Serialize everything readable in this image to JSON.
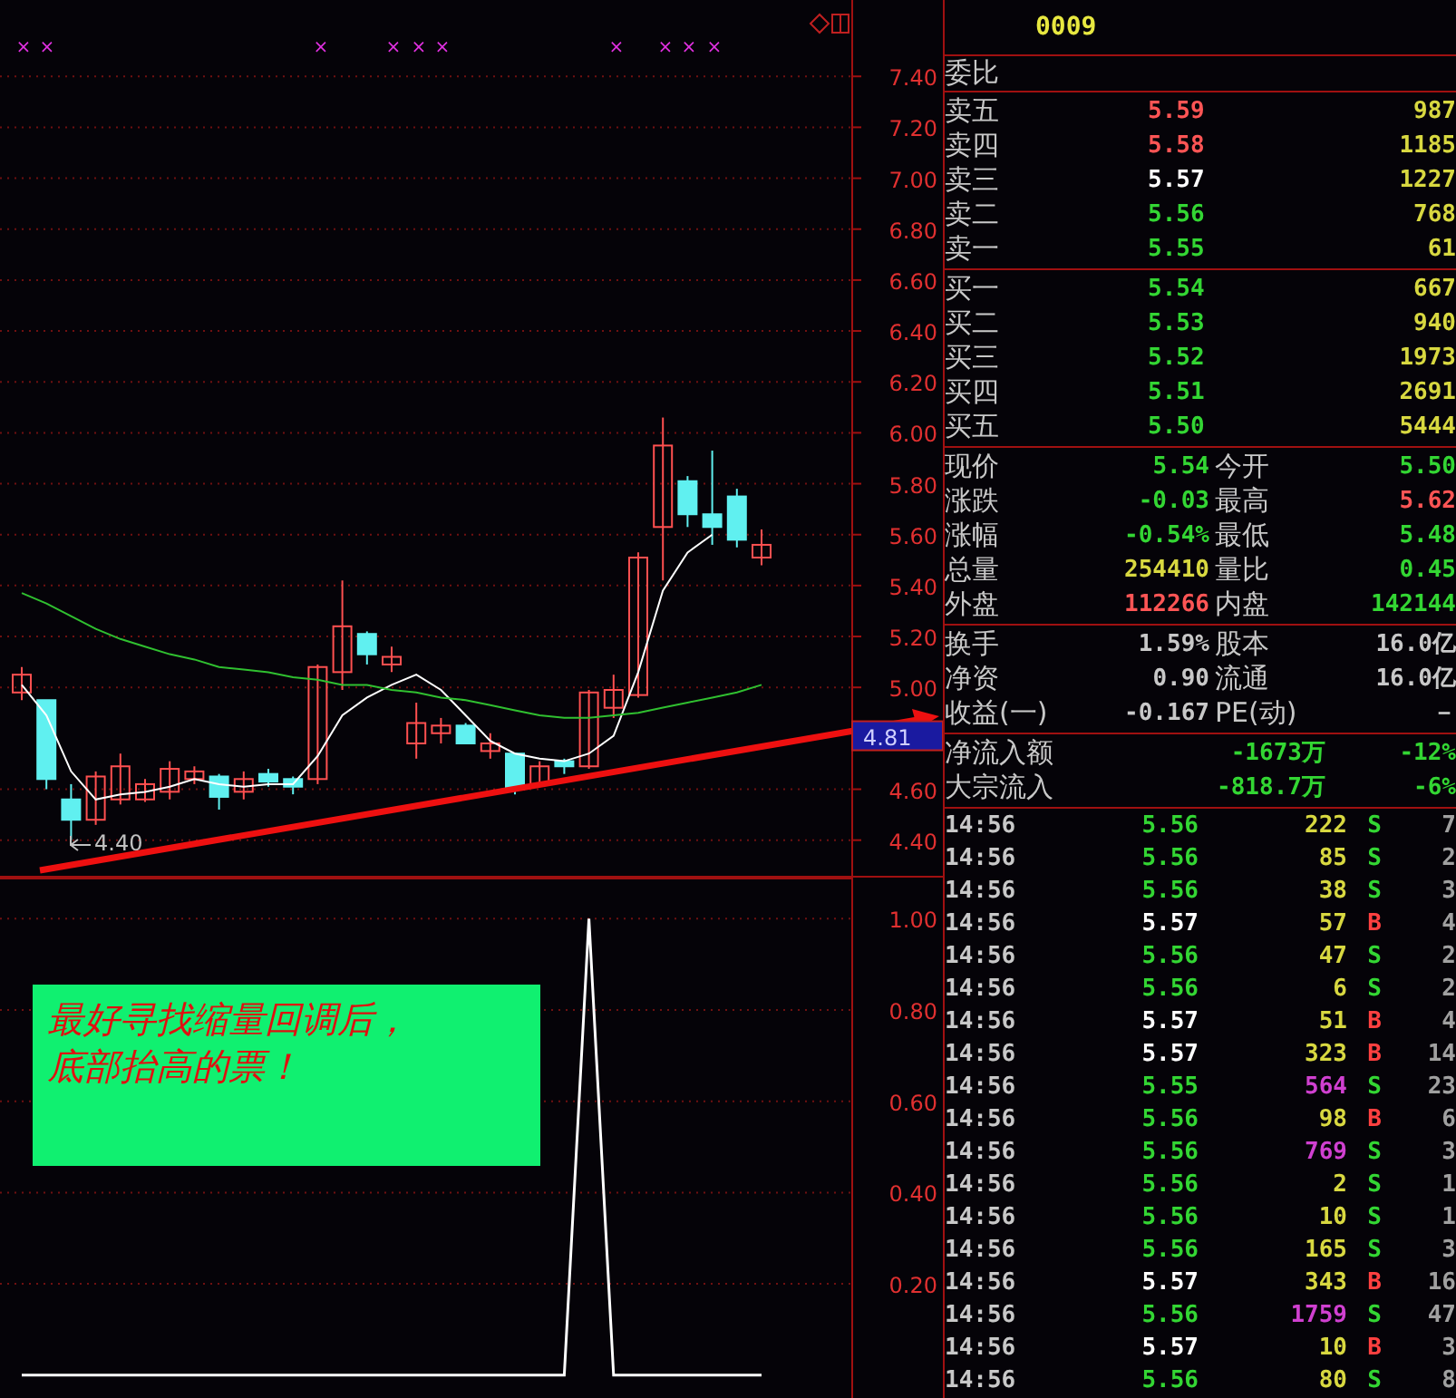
{
  "chart": {
    "chart_data": {
      "type": "candlestick",
      "ylim": [
        4.26,
        7.7
      ],
      "grid": true,
      "yticks": [
        {
          "value": 7.4,
          "label": "7.40"
        },
        {
          "value": 7.2,
          "label": "7.20"
        },
        {
          "value": 7.0,
          "label": "7.00"
        },
        {
          "value": 6.8,
          "label": "6.80"
        },
        {
          "value": 6.6,
          "label": "6.60"
        },
        {
          "value": 6.4,
          "label": "6.40"
        },
        {
          "value": 6.2,
          "label": "6.20"
        },
        {
          "value": 6.0,
          "label": "6.00"
        },
        {
          "value": 5.8,
          "label": "5.80"
        },
        {
          "value": 5.6,
          "label": "5.60"
        },
        {
          "value": 5.4,
          "label": "5.40"
        },
        {
          "value": 5.2,
          "label": "5.20"
        },
        {
          "value": 5.0,
          "label": "5.00"
        },
        {
          "value": 4.6,
          "label": "4.60"
        },
        {
          "value": 4.4,
          "label": "4.40"
        }
      ],
      "ohlc": [
        [
          4.98,
          5.08,
          4.95,
          5.05
        ],
        [
          4.95,
          4.95,
          4.6,
          4.64
        ],
        [
          4.56,
          4.62,
          4.4,
          4.48
        ],
        [
          4.48,
          4.67,
          4.46,
          4.65
        ],
        [
          4.56,
          4.74,
          4.54,
          4.69
        ],
        [
          4.56,
          4.64,
          4.55,
          4.62
        ],
        [
          4.59,
          4.71,
          4.56,
          4.68
        ],
        [
          4.64,
          4.69,
          4.62,
          4.67
        ],
        [
          4.65,
          4.66,
          4.52,
          4.57
        ],
        [
          4.59,
          4.67,
          4.56,
          4.64
        ],
        [
          4.66,
          4.68,
          4.61,
          4.63
        ],
        [
          4.64,
          4.65,
          4.58,
          4.61
        ],
        [
          4.64,
          5.09,
          4.62,
          5.08
        ],
        [
          5.06,
          5.42,
          4.99,
          5.24
        ],
        [
          5.21,
          5.22,
          5.09,
          5.13
        ],
        [
          5.09,
          5.16,
          5.06,
          5.12
        ],
        [
          4.78,
          4.94,
          4.72,
          4.86
        ],
        [
          4.82,
          4.88,
          4.78,
          4.85
        ],
        [
          4.85,
          4.86,
          4.78,
          4.78
        ],
        [
          4.75,
          4.82,
          4.72,
          4.78
        ],
        [
          4.74,
          4.74,
          4.58,
          4.6
        ],
        [
          4.62,
          4.71,
          4.61,
          4.69
        ],
        [
          4.71,
          4.72,
          4.66,
          4.69
        ],
        [
          4.69,
          4.99,
          4.68,
          4.98
        ],
        [
          4.92,
          5.05,
          4.88,
          4.99
        ],
        [
          4.97,
          5.53,
          4.96,
          5.51
        ],
        [
          5.63,
          6.06,
          5.42,
          5.95
        ],
        [
          5.81,
          5.83,
          5.63,
          5.68
        ],
        [
          5.68,
          5.93,
          5.56,
          5.63
        ],
        [
          5.75,
          5.78,
          5.55,
          5.58
        ],
        [
          5.51,
          5.62,
          5.48,
          5.56
        ]
      ],
      "series": [
        {
          "type": "line",
          "color": "#ffffff",
          "values": [
            5.01,
            4.89,
            4.67,
            4.56,
            4.58,
            4.59,
            4.61,
            4.64,
            4.62,
            4.61,
            4.62,
            4.62,
            4.73,
            4.89,
            4.96,
            5.01,
            5.05,
            4.99,
            4.89,
            4.79,
            4.74,
            4.72,
            4.71,
            4.74,
            4.81,
            5.06,
            5.38,
            5.53,
            5.6,
            null,
            null
          ]
        },
        {
          "type": "line",
          "color": "#30c030",
          "values": [
            5.37,
            5.33,
            5.28,
            5.23,
            5.19,
            5.16,
            5.13,
            5.11,
            5.08,
            5.07,
            5.06,
            5.04,
            5.03,
            5.01,
            5.01,
            4.99,
            4.98,
            4.96,
            4.95,
            4.93,
            4.91,
            4.89,
            4.88,
            4.88,
            4.89,
            4.9,
            4.92,
            4.94,
            4.96,
            4.98,
            5.01
          ]
        }
      ]
    },
    "current_price_tag": "4.81",
    "low_marker": "4.40",
    "signal_marks": [
      "×",
      "×",
      "×",
      "×",
      "×",
      "×",
      "×",
      "×",
      "×",
      "×"
    ]
  },
  "indicator": {
    "chart_data": {
      "type": "line",
      "ylim": [
        -0.05,
        1.09
      ],
      "grid": true,
      "yticks": [
        {
          "value": 1.0,
          "label": "1.00"
        },
        {
          "value": 0.8,
          "label": "0.80"
        },
        {
          "value": 0.6,
          "label": "0.60"
        },
        {
          "value": 0.4,
          "label": "0.40"
        },
        {
          "value": 0.2,
          "label": "0.20"
        }
      ],
      "series": [
        {
          "color": "#ffffff",
          "values": [
            0,
            0,
            0,
            0,
            0,
            0,
            0,
            0,
            0,
            0,
            0,
            0,
            0,
            0,
            0,
            0,
            0,
            0,
            0,
            0,
            0,
            0,
            0,
            1.0,
            0,
            0,
            0,
            0,
            0,
            0,
            0
          ]
        }
      ]
    },
    "note_lines": [
      "最好寻找缩量回调后，",
      "底部抬高的票！"
    ]
  },
  "quote_panel": {
    "code": "0009",
    "ratio_label": "委比",
    "asks": [
      {
        "label": "卖五",
        "price": "5.59",
        "color": "#ff5555",
        "volume": "987"
      },
      {
        "label": "卖四",
        "price": "5.58",
        "color": "#ff5555",
        "volume": "1185"
      },
      {
        "label": "卖三",
        "price": "5.57",
        "color": "#ffffff",
        "volume": "1227"
      },
      {
        "label": "卖二",
        "price": "5.56",
        "color": "#33d633",
        "volume": "768"
      },
      {
        "label": "卖一",
        "price": "5.55",
        "color": "#33d633",
        "volume": "61"
      }
    ],
    "bids": [
      {
        "label": "买一",
        "price": "5.54",
        "color": "#33d633",
        "volume": "667"
      },
      {
        "label": "买二",
        "price": "5.53",
        "color": "#33d633",
        "volume": "940"
      },
      {
        "label": "买三",
        "price": "5.52",
        "color": "#33d633",
        "volume": "1973"
      },
      {
        "label": "买四",
        "price": "5.51",
        "color": "#33d633",
        "volume": "2691"
      },
      {
        "label": "买五",
        "price": "5.50",
        "color": "#33d633",
        "volume": "5444"
      }
    ],
    "quote": [
      {
        "cells": [
          {
            "label": "现价",
            "value": "5.54",
            "color": "#33d633"
          },
          {
            "label": "今开",
            "value": "5.50",
            "color": "#33d633"
          }
        ]
      },
      {
        "cells": [
          {
            "label": "涨跌",
            "value": "-0.03",
            "color": "#33d633"
          },
          {
            "label": "最高",
            "value": "5.62",
            "color": "#ff5555"
          }
        ]
      },
      {
        "cells": [
          {
            "label": "涨幅",
            "value": "-0.54%",
            "color": "#33d633"
          },
          {
            "label": "最低",
            "value": "5.48",
            "color": "#33d633"
          }
        ]
      },
      {
        "cells": [
          {
            "label": "总量",
            "value": "254410",
            "color": "#d8d840"
          },
          {
            "label": "量比",
            "value": "0.45",
            "color": "#33d633"
          }
        ]
      },
      {
        "cells": [
          {
            "label": "外盘",
            "value": "112266",
            "color": "#ff5555"
          },
          {
            "label": "内盘",
            "value": "142144",
            "color": "#33d633"
          }
        ]
      }
    ],
    "fundamentals": [
      {
        "cells": [
          {
            "label": "换手",
            "value": "1.59%"
          },
          {
            "label": "股本",
            "value": "16.0亿"
          }
        ]
      },
      {
        "cells": [
          {
            "label": "净资",
            "value": "0.90"
          },
          {
            "label": "流通",
            "value": "16.0亿"
          }
        ]
      },
      {
        "cells": [
          {
            "label": "收益(一)",
            "value": "-0.167"
          },
          {
            "label": "PE(动)",
            "value": "－"
          }
        ]
      }
    ],
    "flows": [
      {
        "label": "净流入额",
        "amount": "-1673万",
        "percent": "-12%",
        "color": "#33d633"
      },
      {
        "label": "大宗流入",
        "amount": "-818.7万",
        "percent": "-6%",
        "color": "#33d633"
      }
    ],
    "trades": [
      {
        "time": "14:56",
        "price": {
          "text": "5.56",
          "color": "#33d633"
        },
        "volume": {
          "text": "222",
          "color": "#d8d840"
        },
        "side": {
          "text": "S",
          "color": "#33d633"
        },
        "count": "7"
      },
      {
        "time": "14:56",
        "price": {
          "text": "5.56",
          "color": "#33d633"
        },
        "volume": {
          "text": "85",
          "color": "#d8d840"
        },
        "side": {
          "text": "S",
          "color": "#33d633"
        },
        "count": "2"
      },
      {
        "time": "14:56",
        "price": {
          "text": "5.56",
          "color": "#33d633"
        },
        "volume": {
          "text": "38",
          "color": "#d8d840"
        },
        "side": {
          "text": "S",
          "color": "#33d633"
        },
        "count": "3"
      },
      {
        "time": "14:56",
        "price": {
          "text": "5.57",
          "color": "#ffffff"
        },
        "volume": {
          "text": "57",
          "color": "#d8d840"
        },
        "side": {
          "text": "B",
          "color": "#ff4040"
        },
        "count": "4"
      },
      {
        "time": "14:56",
        "price": {
          "text": "5.56",
          "color": "#33d633"
        },
        "volume": {
          "text": "47",
          "color": "#d8d840"
        },
        "side": {
          "text": "S",
          "color": "#33d633"
        },
        "count": "2"
      },
      {
        "time": "14:56",
        "price": {
          "text": "5.56",
          "color": "#33d633"
        },
        "volume": {
          "text": "6",
          "color": "#d8d840"
        },
        "side": {
          "text": "S",
          "color": "#33d633"
        },
        "count": "2"
      },
      {
        "time": "14:56",
        "price": {
          "text": "5.57",
          "color": "#ffffff"
        },
        "volume": {
          "text": "51",
          "color": "#d8d840"
        },
        "side": {
          "text": "B",
          "color": "#ff4040"
        },
        "count": "4"
      },
      {
        "time": "14:56",
        "price": {
          "text": "5.57",
          "color": "#ffffff"
        },
        "volume": {
          "text": "323",
          "color": "#d8d840"
        },
        "side": {
          "text": "B",
          "color": "#ff4040"
        },
        "count": "14"
      },
      {
        "time": "14:56",
        "price": {
          "text": "5.55",
          "color": "#33d633"
        },
        "volume": {
          "text": "564",
          "color": "#d040d0"
        },
        "side": {
          "text": "S",
          "color": "#33d633"
        },
        "count": "23"
      },
      {
        "time": "14:56",
        "price": {
          "text": "5.56",
          "color": "#33d633"
        },
        "volume": {
          "text": "98",
          "color": "#d8d840"
        },
        "side": {
          "text": "B",
          "color": "#ff4040"
        },
        "count": "6"
      },
      {
        "time": "14:56",
        "price": {
          "text": "5.56",
          "color": "#33d633"
        },
        "volume": {
          "text": "769",
          "color": "#d040d0"
        },
        "side": {
          "text": "S",
          "color": "#33d633"
        },
        "count": "3"
      },
      {
        "time": "14:56",
        "price": {
          "text": "5.56",
          "color": "#33d633"
        },
        "volume": {
          "text": "2",
          "color": "#d8d840"
        },
        "side": {
          "text": "S",
          "color": "#33d633"
        },
        "count": "1"
      },
      {
        "time": "14:56",
        "price": {
          "text": "5.56",
          "color": "#33d633"
        },
        "volume": {
          "text": "10",
          "color": "#d8d840"
        },
        "side": {
          "text": "S",
          "color": "#33d633"
        },
        "count": "1"
      },
      {
        "time": "14:56",
        "price": {
          "text": "5.56",
          "color": "#33d633"
        },
        "volume": {
          "text": "165",
          "color": "#d8d840"
        },
        "side": {
          "text": "S",
          "color": "#33d633"
        },
        "count": "3"
      },
      {
        "time": "14:56",
        "price": {
          "text": "5.57",
          "color": "#ffffff"
        },
        "volume": {
          "text": "343",
          "color": "#d8d840"
        },
        "side": {
          "text": "B",
          "color": "#ff4040"
        },
        "count": "16"
      },
      {
        "time": "14:56",
        "price": {
          "text": "5.56",
          "color": "#33d633"
        },
        "volume": {
          "text": "1759",
          "color": "#d040d0"
        },
        "side": {
          "text": "S",
          "color": "#33d633"
        },
        "count": "47"
      },
      {
        "time": "14:56",
        "price": {
          "text": "5.57",
          "color": "#ffffff"
        },
        "volume": {
          "text": "10",
          "color": "#d8d840"
        },
        "side": {
          "text": "B",
          "color": "#ff4040"
        },
        "count": "3"
      },
      {
        "time": "14:56",
        "price": {
          "text": "5.56",
          "color": "#33d633"
        },
        "volume": {
          "text": "80",
          "color": "#d8d840"
        },
        "side": {
          "text": "S",
          "color": "#33d633"
        },
        "count": "8"
      }
    ]
  }
}
